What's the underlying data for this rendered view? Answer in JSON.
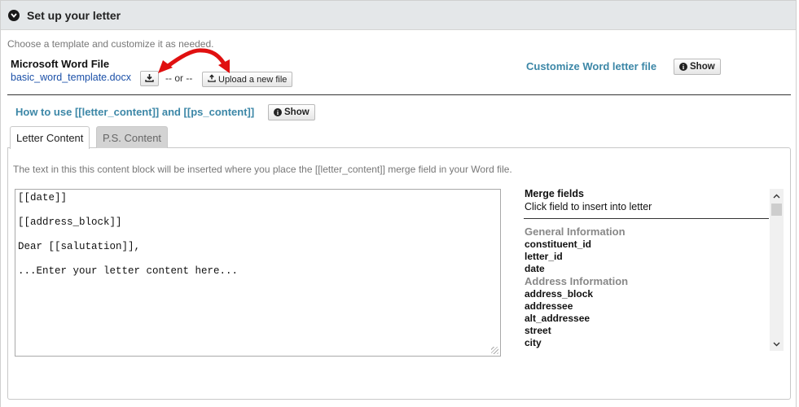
{
  "header": {
    "title": "Set up your letter"
  },
  "intro": "Choose a template and customize it as needed.",
  "word_file": {
    "label": "Microsoft Word File",
    "filename": "basic_word_template.docx",
    "or_text": "-- or --",
    "upload_label": "Upload a new file"
  },
  "customize": {
    "link": "Customize Word letter file",
    "show_label": "Show"
  },
  "howto": {
    "link": "How to use [[letter_content]] and [[ps_content]]",
    "show_label": "Show"
  },
  "tabs": [
    {
      "label": "Letter Content",
      "active": true
    },
    {
      "label": "P.S. Content",
      "active": false
    }
  ],
  "description": "The text in this this content block will be inserted where you place the [[letter_content]] merge field in your Word file.",
  "editor_lines": [
    "[[date]]",
    "",
    "[[address_block]]",
    "",
    "Dear [[salutation]],",
    "",
    "...Enter your letter content here..."
  ],
  "merge": {
    "title": "Merge fields",
    "subtitle": "Click field to insert into letter",
    "groups": [
      {
        "name": "General Information",
        "fields": [
          "constituent_id",
          "letter_id",
          "date"
        ]
      },
      {
        "name": "Address Information",
        "fields": [
          "address_block",
          "addressee",
          "alt_addressee",
          "street",
          "city"
        ]
      }
    ]
  },
  "colors": {
    "link_blue": "#1b50a8",
    "accent_teal": "#3c87a7",
    "arrow_red": "#e01010"
  },
  "icons": {
    "header": "chevron-down-circle-icon",
    "download": "download-icon",
    "upload": "upload-icon",
    "info": "info-circle-icon"
  }
}
